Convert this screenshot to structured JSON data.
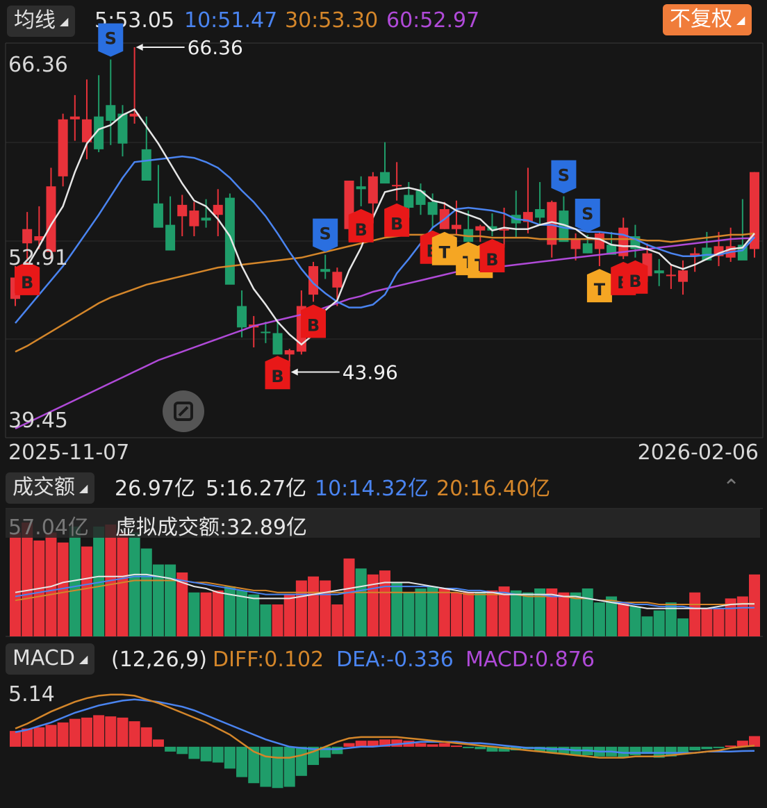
{
  "colors": {
    "up": "#e8323a",
    "down": "#1f9d6a",
    "ma5": "#e6e6e6",
    "ma10": "#4a84f0",
    "ma30": "#d4862a",
    "ma60": "#b04ad8",
    "buy": "#e81818",
    "sell": "#2a6fe0",
    "t": "#f5a623"
  },
  "top": {
    "ma_selector": "均线",
    "ma5": "5:53.05",
    "ma10": "10:51.47",
    "ma30": "30:53.30",
    "ma60": "60:52.97",
    "adjust_button": "不复权",
    "price_high": "66.36",
    "price_mid": "52.91",
    "price_low": "39.45",
    "max_mark": "66.36",
    "min_mark": "43.96",
    "date_start": "2025-11-07",
    "date_end": "2026-02-06"
  },
  "volume": {
    "selector": "成交额",
    "current": "26.97亿",
    "ma5": "5:16.27亿",
    "ma10": "10:14.32亿",
    "ma20": "20:16.40亿",
    "axis_max": "57.04亿",
    "virtual": "虚拟成交额:32.89亿"
  },
  "macd": {
    "selector": "MACD",
    "params": "(12,26,9)",
    "diff": "DIFF:0.102",
    "dea": "DEA:-0.336",
    "macd": "MACD:0.876",
    "axis_max": "5.14"
  },
  "chart_data": [
    {
      "type": "candlestick",
      "title": "",
      "x_range": [
        "2025-11-07",
        "2026-02-06"
      ],
      "ylim": [
        39.45,
        66.36
      ],
      "candles": [
        [
          48.7,
          51.0,
          48.2,
          50.2
        ],
        [
          52.6,
          54.8,
          51.5,
          53.6
        ],
        [
          52.8,
          55.2,
          52.2,
          53.1
        ],
        [
          52.0,
          57.9,
          51.5,
          56.6
        ],
        [
          57.3,
          61.7,
          56.6,
          61.3
        ],
        [
          61.3,
          63.0,
          59.8,
          61.5
        ],
        [
          59.7,
          64.1,
          58.5,
          61.3
        ],
        [
          61.5,
          64.4,
          59.0,
          59.2
        ],
        [
          62.3,
          65.5,
          59.5,
          61.2
        ],
        [
          61.7,
          62.3,
          58.7,
          59.6
        ],
        [
          61.5,
          66.36,
          61.0,
          61.7
        ],
        [
          59.2,
          61.5,
          57.0,
          57.0
        ],
        [
          55.4,
          58.1,
          53.9,
          53.7
        ],
        [
          53.9,
          55.9,
          52.1,
          52.1
        ],
        [
          54.5,
          56.0,
          53.1,
          55.3
        ],
        [
          53.8,
          55.5,
          53.1,
          54.9
        ],
        [
          54.4,
          55.7,
          53.7,
          54.2
        ],
        [
          54.6,
          56.4,
          53.1,
          55.3
        ],
        [
          55.8,
          56.1,
          49.8,
          49.7
        ],
        [
          48.2,
          49.3,
          46.0,
          46.7
        ],
        [
          46.7,
          47.5,
          45.3,
          46.9
        ],
        [
          46.4,
          47.1,
          45.6,
          46.3
        ],
        [
          46.3,
          47.3,
          44.9,
          44.8
        ],
        [
          44.8,
          45.2,
          43.96,
          45.1
        ],
        [
          45.0,
          49.3,
          44.8,
          48.2
        ],
        [
          49.0,
          51.3,
          48.5,
          51.0
        ],
        [
          50.8,
          51.8,
          50.1,
          50.6
        ],
        [
          49.5,
          50.9,
          48.2,
          50.6
        ],
        [
          53.6,
          57.0,
          52.8,
          57.0
        ],
        [
          56.6,
          57.3,
          55.2,
          56.4
        ],
        [
          55.4,
          57.6,
          54.0,
          57.3
        ],
        [
          57.6,
          59.7,
          56.9,
          56.8
        ],
        [
          56.6,
          58.3,
          55.6,
          56.7
        ],
        [
          56.0,
          56.9,
          54.4,
          55.1
        ],
        [
          56.3,
          56.8,
          54.6,
          55.3
        ],
        [
          55.5,
          56.1,
          53.7,
          54.6
        ],
        [
          53.6,
          55.5,
          53.6,
          55.0
        ],
        [
          53.6,
          55.6,
          53.2,
          53.9
        ],
        [
          53.6,
          54.9,
          52.9,
          52.7
        ],
        [
          53.5,
          53.9,
          52.7,
          53.8
        ],
        [
          53.8,
          54.7,
          53.1,
          53.5
        ],
        [
          53.5,
          55.1,
          52.3,
          53.6
        ],
        [
          54.6,
          56.3,
          53.0,
          54.0
        ],
        [
          54.1,
          57.9,
          53.3,
          54.8
        ],
        [
          55.0,
          56.9,
          53.9,
          54.4
        ],
        [
          52.5,
          55.6,
          51.6,
          55.5
        ],
        [
          54.9,
          55.9,
          53.3,
          52.7
        ],
        [
          52.2,
          53.3,
          51.4,
          52.9
        ],
        [
          52.6,
          53.2,
          51.9,
          51.9
        ],
        [
          52.2,
          53.4,
          51.0,
          53.3
        ],
        [
          52.5,
          53.4,
          52.1,
          51.8
        ],
        [
          51.7,
          54.4,
          51.5,
          53.7
        ],
        [
          53.1,
          53.9,
          51.6,
          52.2
        ],
        [
          50.3,
          52.6,
          49.9,
          51.9
        ],
        [
          50.7,
          51.5,
          49.6,
          50.5
        ],
        [
          50.3,
          51.1,
          49.4,
          50.4
        ],
        [
          49.9,
          51.4,
          49.0,
          50.7
        ],
        [
          51.7,
          52.3,
          50.6,
          51.9
        ],
        [
          52.3,
          53.4,
          51.6,
          51.4
        ],
        [
          51.7,
          53.4,
          51.0,
          52.4
        ],
        [
          51.6,
          53.7,
          51.3,
          52.4
        ],
        [
          52.5,
          55.7,
          52.0,
          51.4
        ],
        [
          52.2,
          57.6,
          51.6,
          57.6
        ]
      ],
      "ma5": [
        49.0,
        51.0,
        52.4,
        53.9,
        55.2,
        57.6,
        59.6,
        60.6,
        60.9,
        61.6,
        62.0,
        60.8,
        59.6,
        58.2,
        56.8,
        55.6,
        55.2,
        54.3,
        53.1,
        51.0,
        49.4,
        48.3,
        47.1,
        46.2,
        45.5,
        46.2,
        47.9,
        48.6,
        50.7,
        52.3,
        54.4,
        56.2,
        56.4,
        56.5,
        56.3,
        55.6,
        55.4,
        54.9,
        54.6,
        54.3,
        53.5,
        53.7,
        53.6,
        53.6,
        53.9,
        54.1,
        53.9,
        53.6,
        53.0,
        52.9,
        52.5,
        52.4,
        52.4,
        52.2,
        51.9,
        51.1,
        50.8,
        51.1,
        51.5,
        51.9,
        52.2,
        52.3,
        53.3
      ],
      "ma10": [
        47.0,
        48.0,
        49.0,
        50.0,
        51.0,
        52.2,
        53.4,
        54.6,
        55.9,
        57.2,
        58.3,
        58.4,
        58.5,
        58.6,
        58.7,
        58.6,
        58.3,
        57.9,
        57.2,
        56.3,
        55.5,
        54.5,
        53.3,
        52.0,
        50.8,
        49.8,
        49.1,
        48.5,
        48.1,
        48.1,
        48.3,
        49.0,
        50.5,
        51.5,
        52.6,
        53.7,
        54.3,
        55.0,
        55.1,
        55.0,
        54.9,
        54.7,
        54.3,
        54.2,
        53.9,
        53.9,
        53.7,
        53.6,
        53.4,
        53.4,
        53.3,
        53.2,
        52.9,
        52.5,
        52.2,
        51.9,
        51.7,
        51.7,
        51.8,
        51.8,
        52.0,
        52.1,
        53.05
      ],
      "ma30": [
        45.0,
        45.4,
        45.9,
        46.4,
        46.9,
        47.4,
        47.9,
        48.4,
        48.8,
        49.1,
        49.4,
        49.7,
        49.9,
        50.1,
        50.3,
        50.5,
        50.7,
        50.9,
        51.0,
        51.1,
        51.2,
        51.3,
        51.4,
        51.5,
        51.6,
        51.8,
        52.0,
        52.2,
        52.4,
        52.6,
        52.8,
        53.0,
        53.1,
        53.2,
        53.2,
        53.2,
        53.2,
        53.2,
        53.1,
        53.1,
        53.0,
        53.0,
        53.0,
        53.0,
        52.9,
        52.9,
        52.9,
        52.9,
        52.9,
        52.9,
        52.9,
        52.9,
        52.9,
        52.8,
        52.8,
        52.7,
        52.8,
        52.9,
        53.0,
        53.1,
        53.2,
        53.2,
        53.3
      ],
      "ma60": [
        39.6,
        40.0,
        40.4,
        40.8,
        41.2,
        41.6,
        42.0,
        42.4,
        42.8,
        43.2,
        43.6,
        44.0,
        44.4,
        44.7,
        45.0,
        45.3,
        45.6,
        45.9,
        46.2,
        46.5,
        46.8,
        47.0,
        47.2,
        47.4,
        47.6,
        47.8,
        48.1,
        48.4,
        48.7,
        48.9,
        49.2,
        49.4,
        49.6,
        49.8,
        50.0,
        50.2,
        50.4,
        50.6,
        50.7,
        50.8,
        50.9,
        51.0,
        51.1,
        51.2,
        51.3,
        51.4,
        51.5,
        51.6,
        51.7,
        51.8,
        51.9,
        52.0,
        52.1,
        52.2,
        52.3,
        52.4,
        52.5,
        52.6,
        52.7,
        52.8,
        52.9,
        52.95,
        52.97
      ],
      "signals": [
        {
          "i": 1,
          "type": "B",
          "label": "B"
        },
        {
          "i": 8,
          "type": "S",
          "label": "S"
        },
        {
          "i": 22,
          "type": "B",
          "label": "B"
        },
        {
          "i": 25,
          "type": "B",
          "label": "B"
        },
        {
          "i": 26,
          "type": "S",
          "label": "S"
        },
        {
          "i": 29,
          "type": "B",
          "label": "B"
        },
        {
          "i": 32,
          "type": "B",
          "label": "B"
        },
        {
          "i": 35,
          "type": "B",
          "label": "B"
        },
        {
          "i": 36,
          "type": "T",
          "label": "T"
        },
        {
          "i": 38,
          "type": "T",
          "label": "T"
        },
        {
          "i": 39,
          "type": "T",
          "label": "T"
        },
        {
          "i": 40,
          "type": "B",
          "label": "B"
        },
        {
          "i": 46,
          "type": "S",
          "label": "S"
        },
        {
          "i": 48,
          "type": "S",
          "label": "S"
        },
        {
          "i": 49,
          "type": "T",
          "label": "T"
        },
        {
          "i": 51,
          "type": "B",
          "label": "B"
        },
        {
          "i": 52,
          "type": "B",
          "label": "B"
        }
      ]
    },
    {
      "type": "bar",
      "title": "",
      "ylim": [
        0,
        57.04
      ],
      "values": [
        52,
        57,
        48,
        52,
        47,
        55,
        45,
        55,
        56,
        52,
        52,
        44,
        36,
        36,
        32,
        22,
        22,
        23,
        25,
        23,
        21,
        16,
        16,
        21,
        28,
        30,
        28,
        16,
        39,
        34,
        31,
        33,
        27,
        22,
        24,
        25,
        24,
        22,
        22,
        22,
        23,
        25,
        23,
        22,
        24,
        24,
        22,
        22,
        24,
        17,
        20,
        17,
        15,
        10,
        13,
        17,
        9,
        22,
        14,
        14,
        19,
        20,
        31
      ],
      "colors": [
        "up",
        "up",
        "up",
        "up",
        "up",
        "down",
        "up",
        "down",
        "up",
        "up",
        "down",
        "down",
        "down",
        "down",
        "up",
        "down",
        "up",
        "up",
        "down",
        "down",
        "down",
        "down",
        "up",
        "up",
        "up",
        "up",
        "up",
        "up",
        "up",
        "down",
        "up",
        "up",
        "down",
        "down",
        "down",
        "down",
        "up",
        "up",
        "up",
        "down",
        "up",
        "up",
        "down",
        "down",
        "down",
        "up",
        "up",
        "down",
        "down",
        "down",
        "down",
        "up",
        "down",
        "down",
        "down",
        "down",
        "down",
        "up",
        "up",
        "up",
        "up",
        "up",
        "up"
      ],
      "ma5": [
        22,
        23,
        24,
        25,
        27,
        28,
        29,
        30,
        30,
        30,
        31,
        31,
        30,
        29,
        27,
        25,
        24,
        22,
        21,
        20,
        19,
        19,
        19,
        19,
        20,
        21,
        22,
        23,
        24,
        25,
        26,
        27,
        27,
        27,
        26,
        25,
        24,
        23,
        22,
        22,
        22,
        21,
        21,
        21,
        21,
        21,
        20,
        20,
        19,
        18,
        17,
        16,
        15,
        14,
        14,
        14,
        14,
        14,
        14,
        15,
        16,
        16.27,
        16.27
      ],
      "ma10": [
        20,
        21,
        22,
        23,
        24,
        25,
        26,
        27,
        28,
        29,
        30,
        30,
        30,
        29,
        28,
        27,
        26,
        25,
        24,
        23,
        22,
        21,
        21,
        21,
        21,
        21,
        21,
        21,
        22,
        23,
        24,
        25,
        25,
        25,
        25,
        25,
        24,
        24,
        23,
        23,
        22,
        22,
        21,
        21,
        21,
        20,
        20,
        20,
        19,
        18,
        17,
        17,
        16,
        16,
        15,
        15,
        15,
        14,
        14,
        14,
        14,
        14.32,
        14.32
      ],
      "ma20": [
        18,
        19,
        20,
        21,
        22,
        23,
        24,
        25,
        26,
        27,
        28,
        28,
        28,
        28,
        28,
        27,
        27,
        26,
        25,
        24,
        23,
        23,
        22,
        22,
        22,
        22,
        22,
        22,
        22,
        22,
        22,
        22,
        22,
        22,
        22,
        22,
        22,
        22,
        21,
        21,
        21,
        21,
        21,
        20,
        20,
        20,
        20,
        19,
        19,
        18,
        18,
        17,
        17,
        17,
        16,
        16,
        16,
        16,
        16,
        16,
        16,
        16.4,
        16.4
      ]
    },
    {
      "type": "bar",
      "title": "",
      "ylim": [
        -3.9,
        5.14
      ],
      "values": [
        1.3,
        1.5,
        1.6,
        1.8,
        2.0,
        2.3,
        2.4,
        2.6,
        2.5,
        2.4,
        2.1,
        1.6,
        0.6,
        -0.4,
        -0.6,
        -1.0,
        -1.2,
        -1.3,
        -1.8,
        -2.5,
        -3.0,
        -3.3,
        -3.4,
        -3.3,
        -2.4,
        -1.5,
        -0.9,
        -0.6,
        0.3,
        0.5,
        0.5,
        0.6,
        0.6,
        0.5,
        0.3,
        0.2,
        0.3,
        0.1,
        -0.1,
        -0.2,
        -0.4,
        -0.4,
        -0.3,
        -0.2,
        -0.4,
        -0.5,
        -0.6,
        -0.7,
        -0.7,
        -0.8,
        -0.8,
        -0.9,
        -0.7,
        -0.6,
        -0.9,
        -0.8,
        -0.5,
        -0.3,
        -0.2,
        -0.1,
        0.1,
        0.5,
        0.876
      ],
      "diff": [
        1.5,
        1.9,
        2.4,
        2.9,
        3.3,
        3.7,
        4.0,
        4.2,
        4.3,
        4.3,
        4.2,
        3.9,
        3.6,
        3.2,
        2.8,
        2.4,
        2.0,
        1.5,
        1.0,
        0.3,
        -0.4,
        -0.8,
        -0.9,
        -0.9,
        -0.7,
        -0.4,
        0.0,
        0.4,
        0.7,
        0.8,
        0.8,
        0.8,
        0.8,
        0.7,
        0.6,
        0.5,
        0.4,
        0.3,
        0.2,
        0.1,
        0.0,
        -0.1,
        -0.2,
        -0.3,
        -0.4,
        -0.5,
        -0.6,
        -0.7,
        -0.8,
        -0.9,
        -0.9,
        -0.9,
        -0.8,
        -0.8,
        -0.8,
        -0.7,
        -0.6,
        -0.5,
        -0.4,
        -0.3,
        -0.1,
        0.0,
        0.102
      ],
      "dea": [
        1.2,
        1.4,
        1.7,
        2.0,
        2.4,
        2.8,
        3.1,
        3.4,
        3.6,
        3.8,
        3.9,
        3.8,
        3.7,
        3.5,
        3.3,
        3.0,
        2.6,
        2.2,
        1.8,
        1.4,
        1.0,
        0.6,
        0.3,
        0.0,
        -0.1,
        -0.2,
        -0.2,
        -0.2,
        -0.1,
        0.0,
        0.0,
        0.1,
        0.2,
        0.3,
        0.4,
        0.4,
        0.4,
        0.4,
        0.3,
        0.3,
        0.2,
        0.1,
        0.0,
        -0.1,
        -0.1,
        -0.2,
        -0.2,
        -0.3,
        -0.3,
        -0.4,
        -0.4,
        -0.5,
        -0.5,
        -0.5,
        -0.5,
        -0.5,
        -0.5,
        -0.5,
        -0.4,
        -0.4,
        -0.4,
        -0.35,
        -0.336
      ]
    }
  ]
}
